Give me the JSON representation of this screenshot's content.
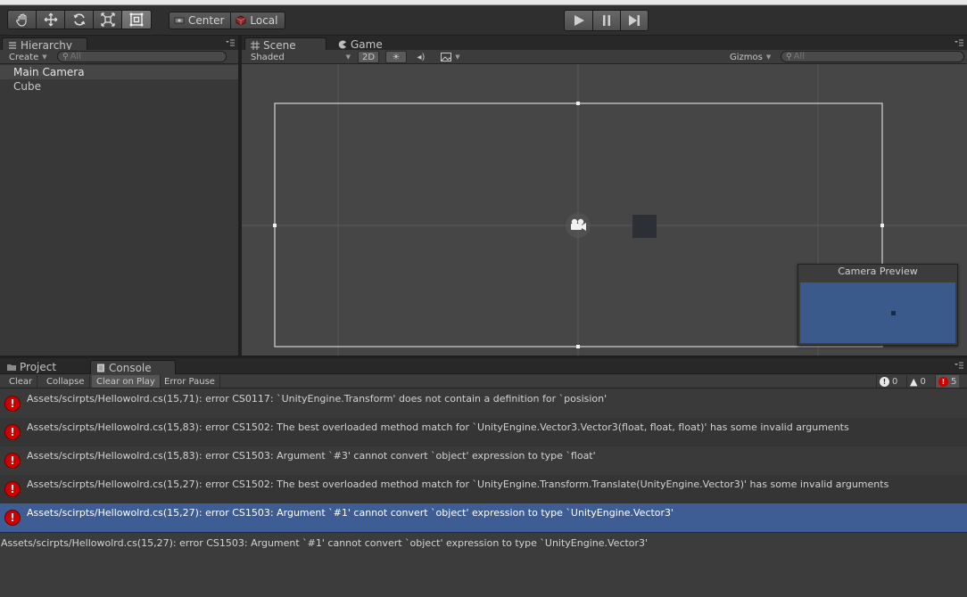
{
  "toolbar": {
    "tools": [
      {
        "name": "hand-tool",
        "icon": "hand-icon",
        "active": false
      },
      {
        "name": "move-tool",
        "icon": "move-icon",
        "active": false
      },
      {
        "name": "rotate-tool",
        "icon": "rotate-icon",
        "active": false
      },
      {
        "name": "scale-tool",
        "icon": "scale-icon",
        "active": false
      },
      {
        "name": "rect-tool",
        "icon": "rect-icon",
        "active": true
      }
    ],
    "pivot_label": "Center",
    "rotation_label": "Local"
  },
  "hierarchy": {
    "tab_label": "Hierarchy",
    "create_label": "Create",
    "search_placeholder": "All",
    "items": [
      {
        "label": "Main Camera",
        "selected": true
      },
      {
        "label": "Cube",
        "selected": false
      }
    ]
  },
  "scene": {
    "tabs": [
      "Scene",
      "Game"
    ],
    "shading_mode": "Shaded",
    "mode_2d": "2D",
    "gizmos_label": "Gizmos",
    "search_placeholder": "All",
    "camera_preview_title": "Camera Preview"
  },
  "console": {
    "tabs": [
      "Project",
      "Console"
    ],
    "buttons": {
      "clear": "Clear",
      "collapse": "Collapse",
      "clear_on_play": "Clear on Play",
      "error_pause": "Error Pause"
    },
    "counts": {
      "info": "0",
      "warnings": "0",
      "errors": "5"
    },
    "messages": [
      "Assets/scirpts/Hellowolrd.cs(15,71): error CS0117: `UnityEngine.Transform' does not contain a definition for `posision'",
      "Assets/scirpts/Hellowolrd.cs(15,83): error CS1502: The best overloaded method match for `UnityEngine.Vector3.Vector3(float, float, float)' has some invalid arguments",
      "Assets/scirpts/Hellowolrd.cs(15,83): error CS1503: Argument `#3' cannot convert `object' expression to type `float'",
      "Assets/scirpts/Hellowolrd.cs(15,27): error CS1502: The best overloaded method match for `UnityEngine.Transform.Translate(UnityEngine.Vector3)' has some invalid arguments",
      "Assets/scirpts/Hellowolrd.cs(15,27): error CS1503: Argument `#1' cannot convert `object' expression to type `UnityEngine.Vector3'"
    ],
    "selected_index": 4,
    "detail": "Assets/scirpts/Hellowolrd.cs(15,27): error CS1503: Argument `#1' cannot convert `object' expression to type `UnityEngine.Vector3'"
  },
  "colors": {
    "selection_blue": "#3d5d94",
    "error_red": "#cc0000",
    "camera_preview_bg": "#3a5a8c"
  }
}
